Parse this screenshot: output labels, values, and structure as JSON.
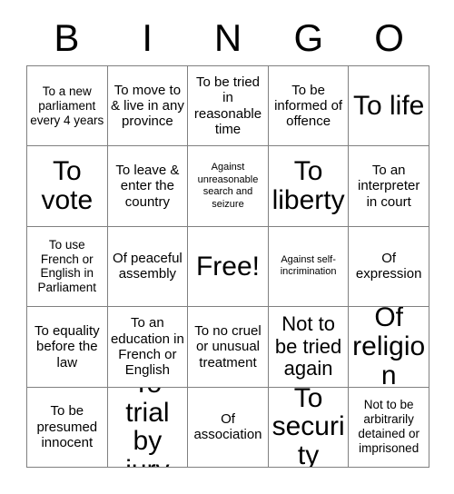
{
  "header": {
    "letters": [
      "B",
      "I",
      "N",
      "G",
      "O"
    ]
  },
  "grid": {
    "rows": [
      [
        {
          "text": "To a new parliament every 4 years",
          "size": "sm"
        },
        {
          "text": "To move to & live in any province",
          "size": "md"
        },
        {
          "text": "To be tried in reasonable time",
          "size": "md"
        },
        {
          "text": "To be informed of offence",
          "size": "md"
        },
        {
          "text": "To life",
          "size": "xl"
        }
      ],
      [
        {
          "text": "To vote",
          "size": "xl"
        },
        {
          "text": "To leave & enter the country",
          "size": "md"
        },
        {
          "text": "Against unreasonable search and seizure",
          "size": "xs"
        },
        {
          "text": "To liberty",
          "size": "xl"
        },
        {
          "text": "To an interpreter in court",
          "size": "md"
        }
      ],
      [
        {
          "text": "To use French or English in Parliament",
          "size": "sm"
        },
        {
          "text": "Of peaceful assembly",
          "size": "md"
        },
        {
          "text": "Free!",
          "size": "xl"
        },
        {
          "text": "Against self-incrimination",
          "size": "xs"
        },
        {
          "text": "Of expression",
          "size": "md"
        }
      ],
      [
        {
          "text": "To equality before the law",
          "size": "md"
        },
        {
          "text": "To an education in French or English",
          "size": "md"
        },
        {
          "text": "To no cruel or unusual treatment",
          "size": "md"
        },
        {
          "text": "Not to be tried again",
          "size": "lg"
        },
        {
          "text": "Of religion",
          "size": "xl"
        }
      ],
      [
        {
          "text": "To be presumed innocent",
          "size": "md"
        },
        {
          "text": "To trial by jury",
          "size": "xl"
        },
        {
          "text": "Of association",
          "size": "md"
        },
        {
          "text": "To security",
          "size": "xl"
        },
        {
          "text": "Not to be arbitrarily detained or imprisoned",
          "size": "sm"
        }
      ]
    ]
  },
  "colors": {
    "background": "#ffffff",
    "text": "#000000",
    "grid_line": "#808080"
  }
}
